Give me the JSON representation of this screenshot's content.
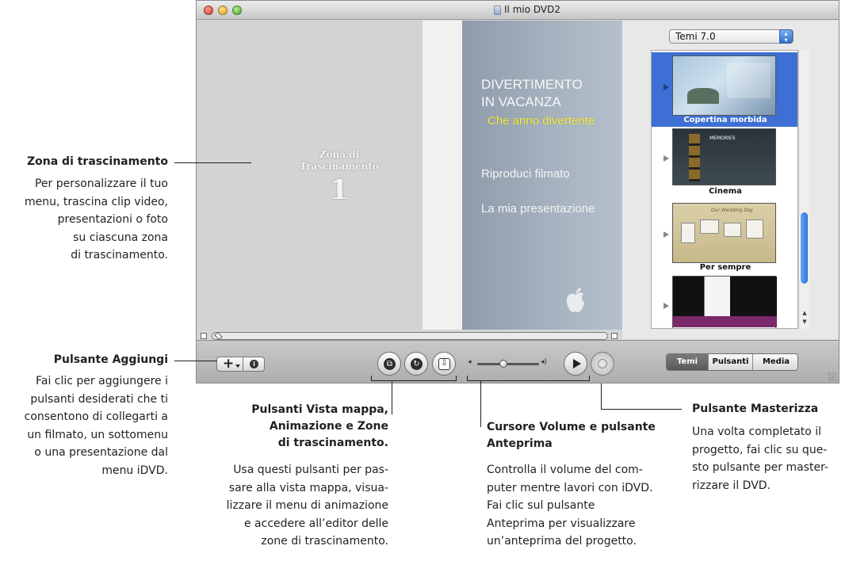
{
  "window": {
    "title": "Il mio DVD2"
  },
  "menu_preview": {
    "dropzone_label_line1": "Zona di",
    "dropzone_label_line2": "Trascinamento",
    "dropzone_number": "1",
    "title_line1": "DIVERTIMENTO",
    "title_line2": "IN VACANZA",
    "subtitle": "Che anno divertente",
    "buttons": [
      "Riproduci filmato",
      "La mia presentazione"
    ]
  },
  "theme_panel": {
    "selector_value": "Temi 7.0",
    "themes": [
      {
        "name": "Copertina morbida",
        "selected": true
      },
      {
        "name": "Cinema",
        "selected": false
      },
      {
        "name": "Per sempre",
        "selected": false
      },
      {
        "name": "",
        "selected": false
      }
    ],
    "thumb_text": {
      "cinema": "MEMORIES",
      "forever": "Our Wedding Day"
    }
  },
  "toolbar": {
    "add_symbol": "+",
    "info_symbol": "i",
    "segments": [
      {
        "label": "Temi",
        "active": true
      },
      {
        "label": "Pulsanti",
        "active": false
      },
      {
        "label": "Media",
        "active": false
      }
    ]
  },
  "callouts": {
    "dropzone": {
      "title": "Zona di trascinamento",
      "lines": [
        "Per personalizzare il tuo",
        "menu, trascina clip video,",
        "presentazioni o foto",
        "su ciascuna zona",
        "di trascinamento."
      ]
    },
    "add_button": {
      "title": "Pulsante Aggiungi",
      "lines": [
        "Fai clic per aggiungere i",
        "pulsanti desiderati che ti",
        "consentono di collegarti a",
        "un filmato, un sottomenu",
        "o una presentazione dal",
        "menu iDVD."
      ]
    },
    "map_buttons": {
      "title_lines": [
        "Pulsanti Vista mappa,",
        "Animazione e Zone",
        "di trascinamento."
      ],
      "lines": [
        "Usa questi pulsanti per pas-",
        "sare alla vista mappa, visua-",
        "lizzare il menu di animazione",
        "e accedere all’editor delle",
        "zone di trascinamento."
      ]
    },
    "volume": {
      "title_lines": [
        "Cursore Volume e pulsante",
        "Anteprima"
      ],
      "lines": [
        "Controlla il volume del com-",
        "puter mentre lavori con iDVD.",
        "Fai clic sul pulsante",
        "Anteprima per visualizzare",
        "un’anteprima del progetto."
      ]
    },
    "burn": {
      "title": "Pulsante Masterizza",
      "lines": [
        "Una volta completato il",
        "progetto, fai clic su que-",
        "sto pulsante per master-",
        "rizzare il DVD."
      ]
    }
  }
}
